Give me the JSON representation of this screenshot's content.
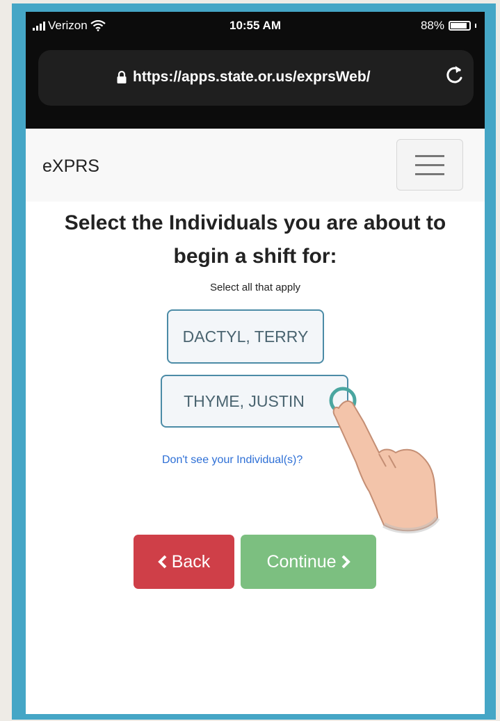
{
  "status_bar": {
    "carrier": "Verizon",
    "time": "10:55 AM",
    "battery": "88%",
    "battery_level": 0.88
  },
  "browser": {
    "url": "https://apps.state.or.us/exprsWeb/",
    "lock_icon": "lock-icon",
    "reload_icon": "reload-icon"
  },
  "navbar": {
    "brand": "eXPRS",
    "menu_icon": "hamburger-menu-icon"
  },
  "main": {
    "heading_line1": "Select the Individuals you are about to",
    "heading_line2": "begin a shift for:",
    "subheading": "Select all that apply",
    "individuals": [
      {
        "name": "DACTYL, TERRY"
      },
      {
        "name": "THYME, JUSTIN"
      }
    ],
    "missing_link": "Don't see your Individual(s)?"
  },
  "buttons": {
    "back": "Back",
    "continue": "Continue"
  },
  "colors": {
    "frame": "#45a6c6",
    "back_button": "#cf3f48",
    "continue_button": "#7cbf80",
    "link": "#2d6fd6"
  }
}
